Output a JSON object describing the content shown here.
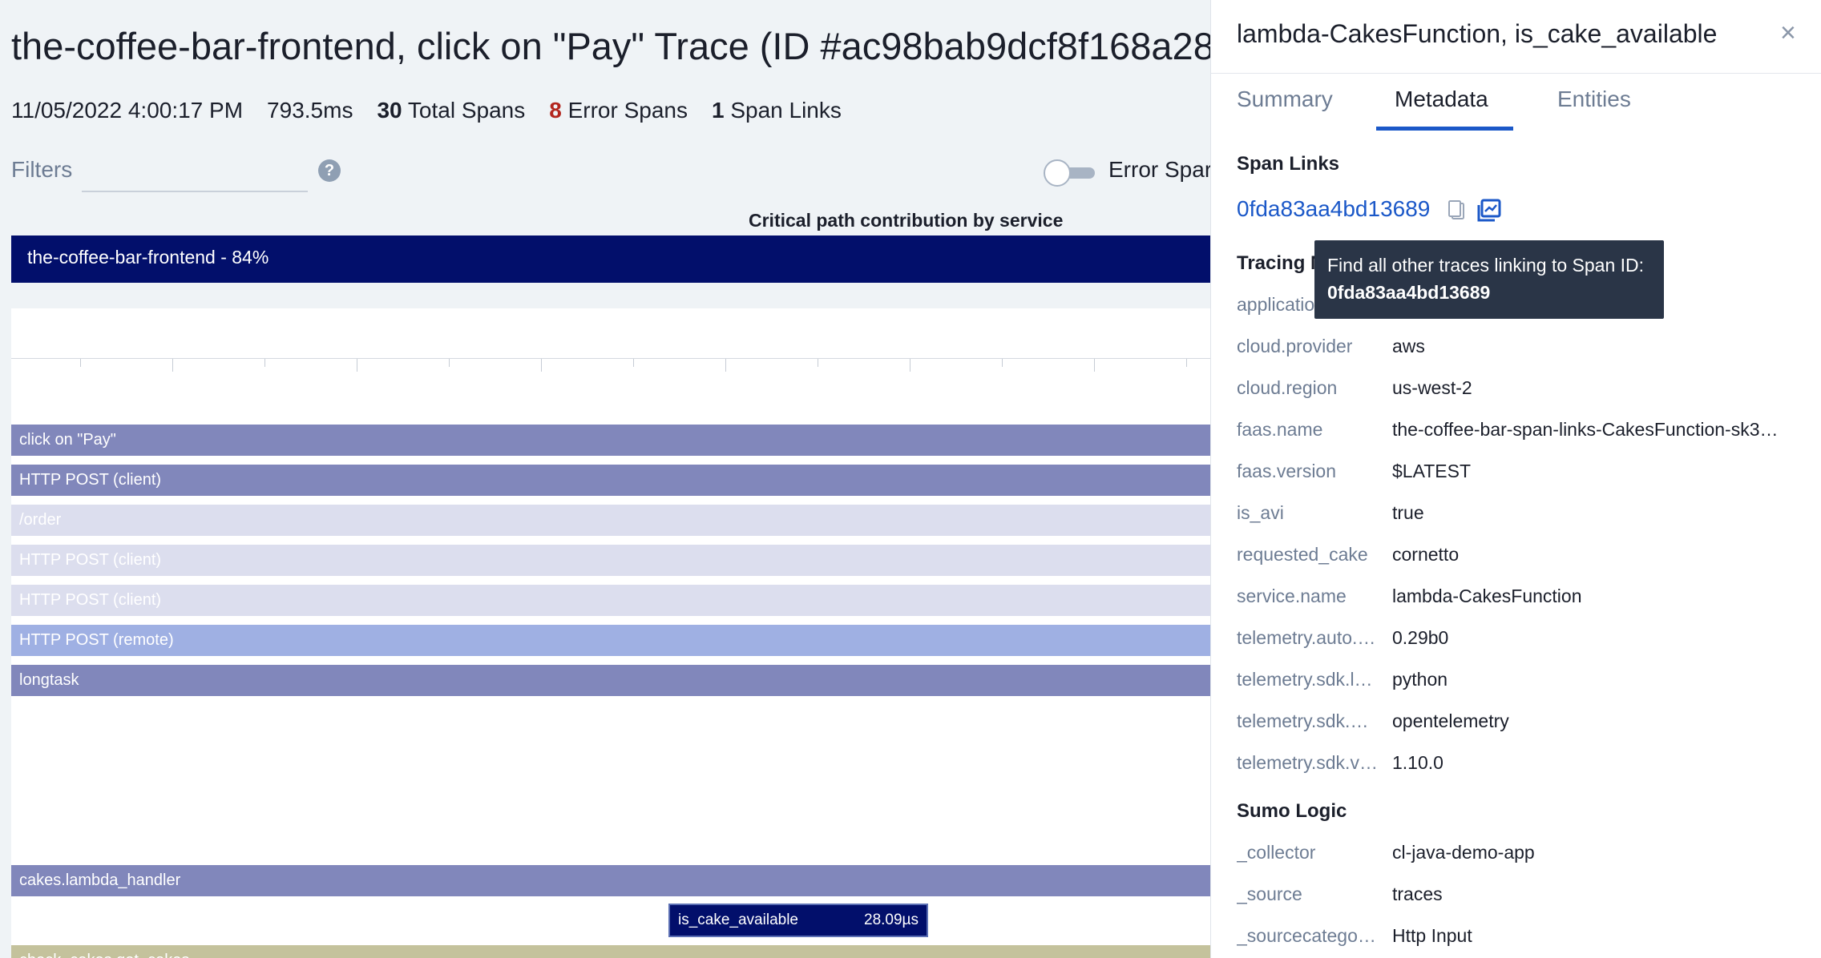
{
  "trace": {
    "title": "the-coffee-bar-frontend, click on \"Pay\" Trace (ID #ac98bab9dcf8f168a28",
    "timestamp": "11/05/2022 4:00:17 PM",
    "duration": "793.5ms",
    "total_spans_count": "30",
    "total_spans_label": "Total Spans",
    "error_spans_count": "8",
    "error_spans_label": "Error Spans",
    "span_links_count": "1",
    "span_links_label": "Span Links"
  },
  "filters": {
    "label": "Filters",
    "value": "",
    "help_glyph": "?",
    "error_toggle_label": "Error Spar"
  },
  "critical_path": {
    "title": "Critical path contribution by service",
    "bar_label": "the-coffee-bar-frontend - 84%"
  },
  "spans": [
    {
      "label": "click on \"Pay\"",
      "color": "#8187bb"
    },
    {
      "label": "HTTP POST (client)",
      "color": "#8187bb"
    },
    {
      "label": "/order",
      "color": "#dcdeee"
    },
    {
      "label": "HTTP POST (client)",
      "color": "#dcdeee"
    },
    {
      "label": "HTTP POST (client)",
      "color": "#dcdeee"
    },
    {
      "label": "HTTP POST (remote)",
      "color": "#9fb0e3"
    },
    {
      "label": "longtask",
      "color": "#8187bb"
    },
    {
      "label": "cakes.lambda_handler",
      "color": "#8187bb"
    },
    {
      "label": "check_cakes.get_cakes",
      "color": "#c4c29c"
    }
  ],
  "selected_span": {
    "name": "is_cake_available",
    "duration": "28.09µs",
    "color": "#020f6b"
  },
  "panel": {
    "title": "lambda-CakesFunction, is_cake_available",
    "close_glyph": "×",
    "tabs": [
      {
        "label": "Summary",
        "active": false
      },
      {
        "label": "Metadata",
        "active": true
      },
      {
        "label": "Entities",
        "active": false
      }
    ],
    "span_links_heading": "Span Links",
    "span_link_id": "0fda83aa4bd13689",
    "tracing_heading": "Tracing M",
    "tracing_rows": [
      {
        "key": "applicatio",
        "value": ""
      },
      {
        "key": "cloud.provider",
        "value": "aws"
      },
      {
        "key": "cloud.region",
        "value": "us-west-2"
      },
      {
        "key": "faas.name",
        "value": "the-coffee-bar-span-links-CakesFunction-sk3…"
      },
      {
        "key": "faas.version",
        "value": "$LATEST"
      },
      {
        "key": "is_avi",
        "value": "true"
      },
      {
        "key": "requested_cake",
        "value": "cornetto"
      },
      {
        "key": "service.name",
        "value": "lambda-CakesFunction"
      },
      {
        "key": "telemetry.auto.…",
        "value": "0.29b0"
      },
      {
        "key": "telemetry.sdk.l…",
        "value": "python"
      },
      {
        "key": "telemetry.sdk.…",
        "value": "opentelemetry"
      },
      {
        "key": "telemetry.sdk.v…",
        "value": "1.10.0"
      }
    ],
    "sumo_heading": "Sumo Logic",
    "sumo_rows": [
      {
        "key": "_collector",
        "value": "cl-java-demo-app"
      },
      {
        "key": "_source",
        "value": "traces"
      },
      {
        "key": "_sourcecatego…",
        "value": "Http Input"
      }
    ]
  },
  "tooltip": {
    "text": "Find all other traces linking to Span ID:",
    "id": "0fda83aa4bd13689"
  },
  "colors": {
    "accent": "#1b58c8",
    "error": "#b3261e",
    "critical_bar": "#020f6b"
  }
}
